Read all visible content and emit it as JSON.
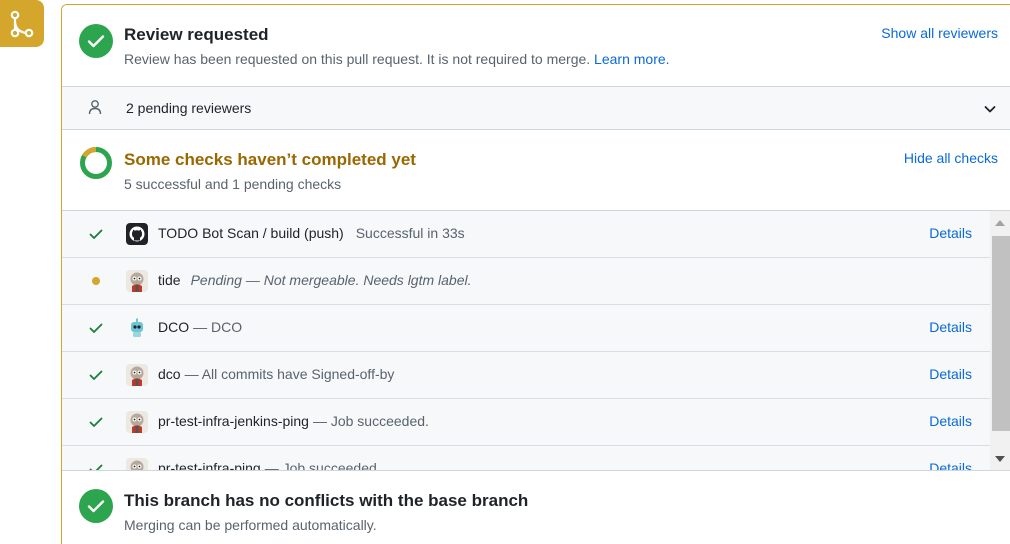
{
  "review": {
    "title": "Review requested",
    "description": "Review has been requested on this pull request. It is not required to merge.",
    "learn_more": "Learn more.",
    "show_all": "Show all reviewers"
  },
  "pending": {
    "label": "2 pending reviewers"
  },
  "checks": {
    "title": "Some checks haven’t completed yet",
    "summary": "5 successful and 1 pending checks",
    "hide_all": "Hide all checks",
    "title_color": "#9a6700",
    "items": [
      {
        "status": "success",
        "name": "TODO Bot Scan / build (push)",
        "desc": "Successful in 33s",
        "details": "Details",
        "avatar_icon": "github-icon"
      },
      {
        "status": "pending",
        "name": "tide",
        "desc": "Pending — Not mergeable. Needs lgtm label.",
        "details": "",
        "avatar_icon": "robot-avatar-icon"
      },
      {
        "status": "success",
        "name": "DCO",
        "desc": "— DCO",
        "details": "Details",
        "avatar_icon": "dco-bot-icon"
      },
      {
        "status": "success",
        "name": "dco",
        "desc": "— All commits have Signed-off-by",
        "details": "Details",
        "avatar_icon": "robot-avatar-icon"
      },
      {
        "status": "success",
        "name": "pr-test-infra-jenkins-ping",
        "desc": "— Job succeeded.",
        "details": "Details",
        "avatar_icon": "robot-avatar-icon"
      },
      {
        "status": "success",
        "name": "pr-test-infra-ping",
        "desc": "— Job succeeded.",
        "details": "Details",
        "avatar_icon": "robot-avatar-icon"
      }
    ]
  },
  "merge": {
    "title": "This branch has no conflicts with the base branch",
    "subtitle": "Merging can be performed automatically."
  },
  "colors": {
    "success": "#1a7f37",
    "success_bg": "#2da44e",
    "pending": "#d4a72c",
    "badge": "#d4a72c",
    "link": "#0969da"
  }
}
